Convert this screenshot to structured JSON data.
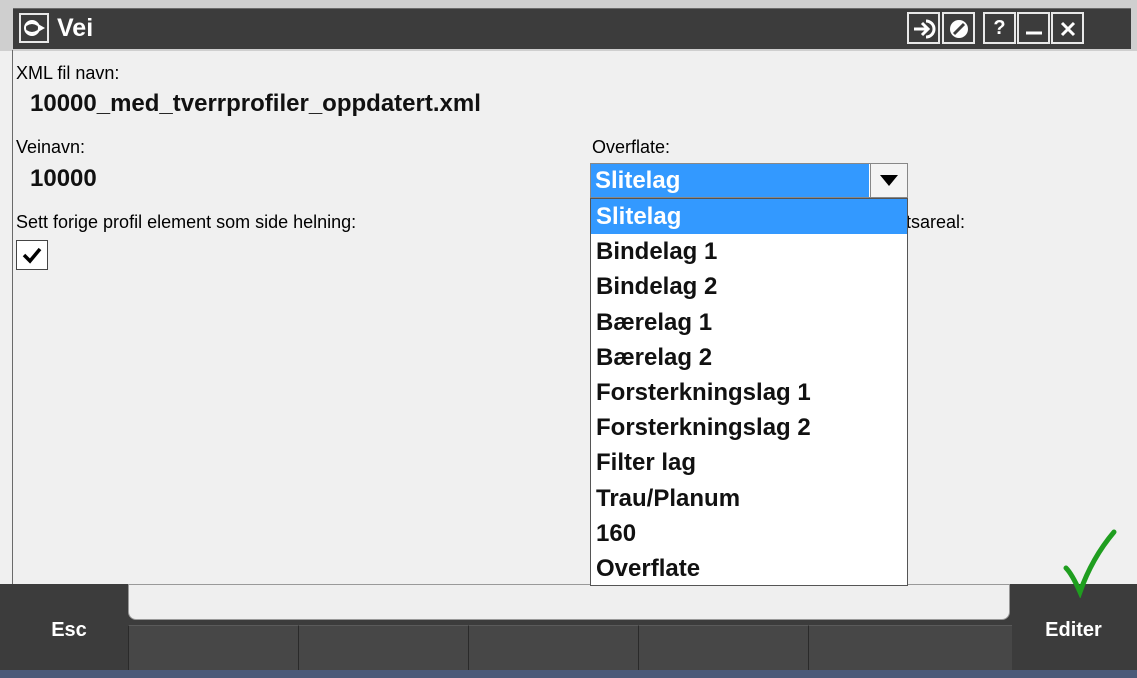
{
  "window": {
    "title": "Vei",
    "buttons": {
      "help": "?"
    }
  },
  "form": {
    "xml_label": "XML fil navn:",
    "xml_value": "10000_med_tverrprofiler_oppdatert.xml",
    "veinavn_label": "Veinavn:",
    "veinavn_value": "10000",
    "overflate_label": "Overflate:",
    "overflate_value": "Slitelag",
    "sett_label": "Sett forige profil element som side helning:",
    "sett_checked": true,
    "hidden_label_fragment": "tsareal:"
  },
  "dropdown": {
    "options": [
      "Slitelag",
      "Bindelag 1",
      "Bindelag 2",
      "Bærelag 1",
      "Bærelag 2",
      "Forsterkningslag 1",
      "Forsterkningslag 2",
      "Filter lag",
      "Trau/Planum",
      "160",
      "Overflate"
    ],
    "selected_index": 0,
    "highlight_color": "#3399ff"
  },
  "bottom": {
    "esc_label": "Esc",
    "editer_label": "Editer",
    "accept_color": "#1f9e1f"
  },
  "icons": {
    "app": "trimble-globe-icon",
    "login": "arrow-right-icon",
    "status": "no-entry-icon",
    "help": "help-icon",
    "minimize": "minimize-icon",
    "close": "close-icon",
    "dropdown": "chevron-down-icon",
    "checkbox": "checkmark-icon",
    "accept": "green-check-icon"
  }
}
